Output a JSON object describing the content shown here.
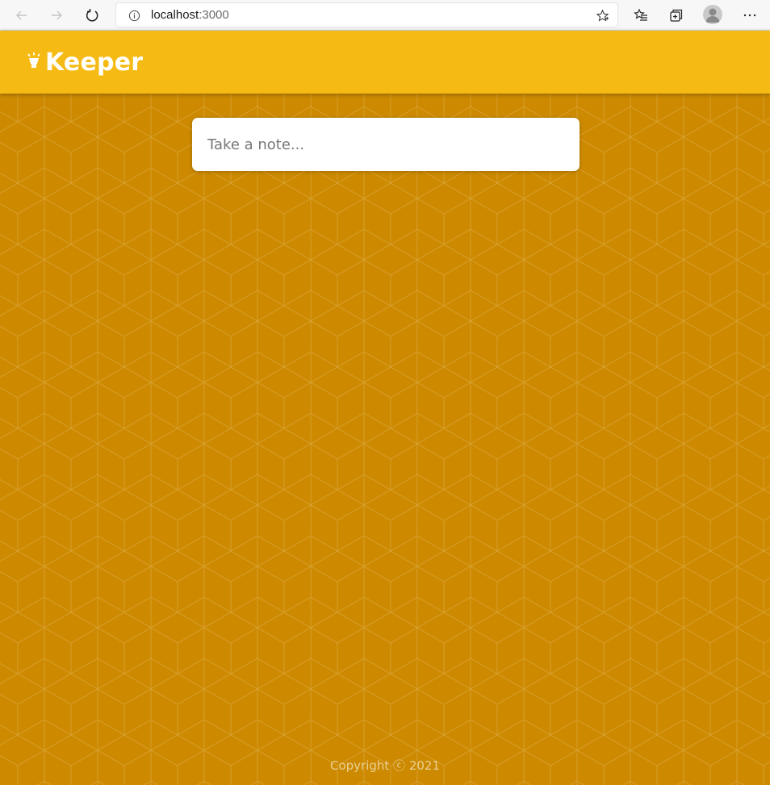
{
  "browser": {
    "url_host": "localhost",
    "url_port": ":3000",
    "icons": [
      "back-arrow-icon",
      "forward-arrow-icon",
      "refresh-icon",
      "info-icon",
      "star-icon",
      "favorites-icon",
      "collections-icon",
      "profile-icon",
      "more-icon"
    ]
  },
  "header": {
    "title": "Keeper",
    "logo_icon": "lightbulb-icon"
  },
  "note_form": {
    "placeholder": "Take a note..."
  },
  "footer": {
    "text": "Copyright ⓒ 2021"
  },
  "colors": {
    "header_bg": "#f5ba13",
    "page_bg": "#cd8a00",
    "pattern_stroke": "#dba43a",
    "footer_text": "#e9cf93"
  }
}
